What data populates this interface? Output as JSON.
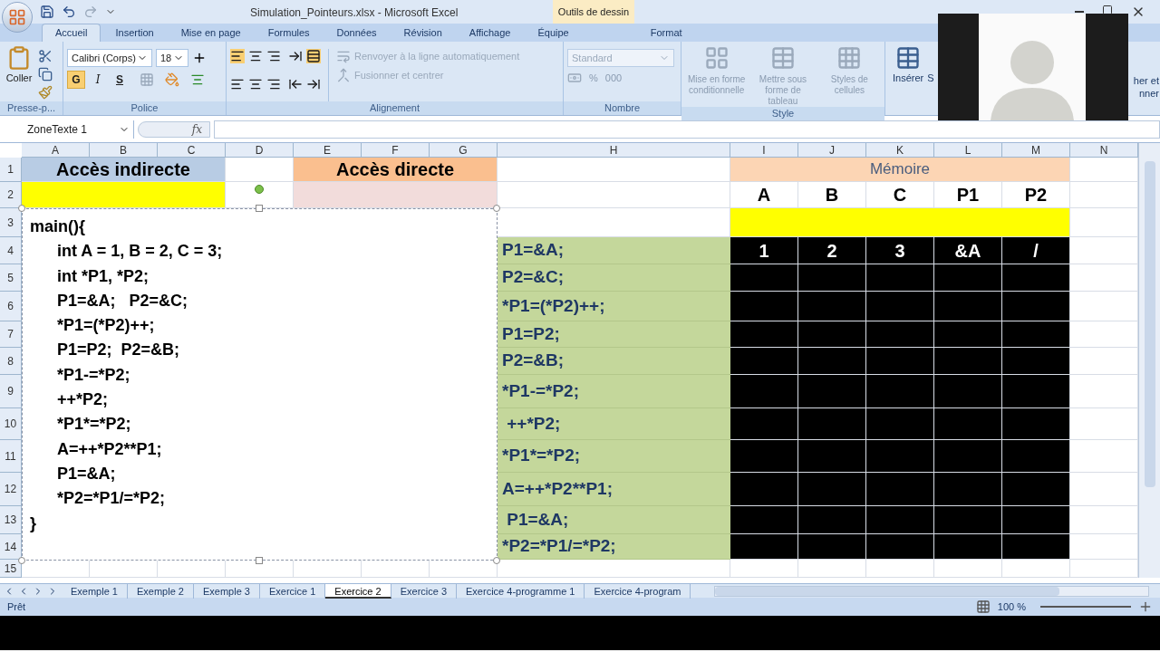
{
  "window": {
    "title": "Simulation_Pointeurs.xlsx - Microsoft Excel",
    "contextual_group": "Outils de dessin"
  },
  "ribbon": {
    "tabs": [
      {
        "label": "Accueil",
        "selected": true,
        "kind": "main"
      },
      {
        "label": "Insertion",
        "selected": false,
        "kind": "main"
      },
      {
        "label": "Mise en page",
        "selected": false,
        "kind": "main"
      },
      {
        "label": "Formules",
        "selected": false,
        "kind": "main"
      },
      {
        "label": "Données",
        "selected": false,
        "kind": "main"
      },
      {
        "label": "Révision",
        "selected": false,
        "kind": "main"
      },
      {
        "label": "Affichage",
        "selected": false,
        "kind": "main"
      },
      {
        "label": "Équipe",
        "selected": false,
        "kind": "main"
      },
      {
        "label": "Format",
        "selected": false,
        "kind": "contextual"
      }
    ],
    "clipboard": {
      "paste": "Coller",
      "group": "Presse-p..."
    },
    "font": {
      "name": "Calibri (Corps)",
      "size": "18",
      "bold": "G",
      "italic": "I",
      "underline": "S",
      "group": "Police"
    },
    "alignment": {
      "wrap": "Renvoyer à la ligne automatiquement",
      "merge": "Fusionner et centrer",
      "group": "Alignement"
    },
    "number": {
      "format": "Standard",
      "percent": "%",
      "thousands": "000",
      "group": "Nombre"
    },
    "style": {
      "buttons": [
        "Mise en forme conditionnelle",
        "Mettre sous forme de tableau",
        "Styles de cellules"
      ],
      "group": "Style"
    },
    "cells": {
      "insert": "Insérer",
      "cut_letter": "S"
    },
    "editing": {
      "line1": "her et",
      "line2": "nner"
    }
  },
  "formula_bar": {
    "name_box": "ZoneTexte 1",
    "fx": "fx"
  },
  "sheet": {
    "columns": [
      "A",
      "B",
      "C",
      "D",
      "E",
      "F",
      "G",
      "H",
      "I",
      "J",
      "K",
      "L",
      "M",
      "N"
    ],
    "row_numbers": [
      "1",
      "2",
      "3",
      "4",
      "5",
      "6",
      "7",
      "8",
      "9",
      "10",
      "11",
      "12",
      "13",
      "14",
      "15"
    ],
    "indirect_title": "Accès indirecte",
    "direct_title": "Accès directe",
    "memory_title": "Mémoire",
    "memory_vars": [
      "A",
      "B",
      "C",
      "P1",
      "P2"
    ],
    "memory_values": [
      "1",
      "2",
      "3",
      "&A",
      "/"
    ],
    "instructions": [
      "P1=&A;",
      "P2=&C;",
      "*P1=(*P2)++;",
      "P1=P2;",
      "P2=&B;",
      "*P1-=*P2;",
      " ++*P2;",
      "*P1*=*P2;",
      "A=++*P2**P1;",
      " P1=&A;",
      "*P2=*P1/=*P2;"
    ],
    "code": [
      {
        "text": "main(){",
        "children": [
          {
            "text": "int A = 1, B = 2, C = 3;"
          },
          {
            "text": "int *P1, *P2;"
          },
          {
            "text": "P1=&A;   P2=&C;"
          },
          {
            "text": "*P1=(*P2)++;"
          },
          {
            "text": "P1=P2;  P2=&B;"
          },
          {
            "text": "*P1-=*P2;"
          },
          {
            "text": "++*P2;"
          },
          {
            "text": "*P1*=*P2;"
          },
          {
            "text": "A=++*P2**P1;"
          },
          {
            "text": "P1=&A;"
          },
          {
            "text": "*P2=*P1/=*P2;"
          }
        ]
      },
      {
        "text": "}"
      }
    ]
  },
  "sheet_tabs": [
    {
      "label": "Exemple 1",
      "selected": false
    },
    {
      "label": "Exemple 2",
      "selected": false
    },
    {
      "label": "Exemple 3",
      "selected": false
    },
    {
      "label": "Exercice 1",
      "selected": false
    },
    {
      "label": "Exercice 2",
      "selected": true
    },
    {
      "label": "Exercice 3",
      "selected": false
    },
    {
      "label": "Exercice 4-programme 1",
      "selected": false
    },
    {
      "label": "Exercice 4-program",
      "selected": false
    }
  ],
  "status_bar": {
    "ready": "Prêt",
    "zoom": "100 %"
  }
}
